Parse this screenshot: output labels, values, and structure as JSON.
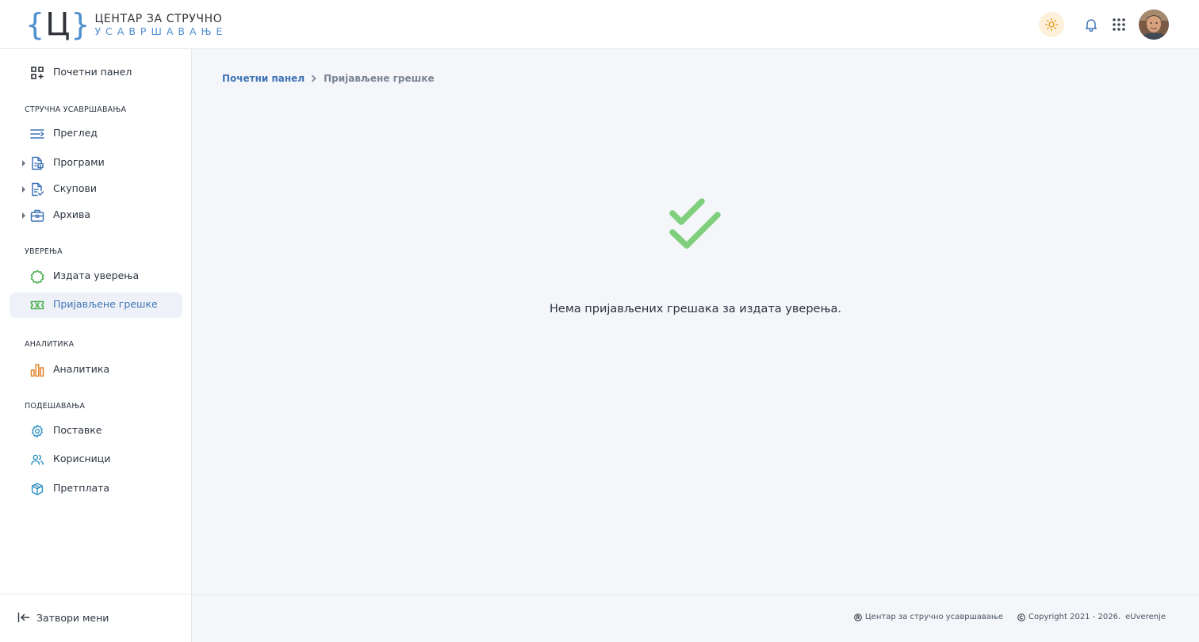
{
  "brand": {
    "logo_letter": "Ц",
    "line1": "ЦЕНТАР ЗА СТРУЧНО",
    "line2": "УСАВРШАВАЊЕ"
  },
  "header": {
    "theme_icon": "sun-icon",
    "notifications_icon": "bell-icon",
    "apps_icon": "grid-icon",
    "avatar": "user-avatar"
  },
  "sidebar": {
    "dashboard": {
      "label": "Почетни панел",
      "icon": "dashboard-icon"
    },
    "sections": {
      "training": "СТРУЧНА УСАВРШАВАЊА",
      "certificates": "УВЕРЕЊА",
      "analytics": "АНАЛИТИКА",
      "settings": "ПОДЕШАВАЊА"
    },
    "items": {
      "overview": {
        "label": "Преглед",
        "icon": "list-icon"
      },
      "programs": {
        "label": "Програми",
        "icon": "programs-icon"
      },
      "gatherings": {
        "label": "Скупови",
        "icon": "gatherings-icon"
      },
      "archive": {
        "label": "Архива",
        "icon": "archive-icon"
      },
      "issued": {
        "label": "Издата уверења",
        "icon": "badge-icon"
      },
      "reported": {
        "label": "Пријављене грешке",
        "icon": "ticket-x-icon"
      },
      "analytics": {
        "label": "Аналитика",
        "icon": "bar-chart-icon"
      },
      "preferences": {
        "label": "Поставке",
        "icon": "gear-icon"
      },
      "users": {
        "label": "Корисници",
        "icon": "users-icon"
      },
      "subscription": {
        "label": "Претплата",
        "icon": "box-icon"
      }
    },
    "close_menu": "Затвори мени"
  },
  "breadcrumb": {
    "home": "Почетни панел",
    "current": "Пријављене грешке"
  },
  "empty_state": {
    "icon": "double-check-icon",
    "message": "Нема пријављених грешака за издата уверења."
  },
  "footer": {
    "org": "Центар за стручно усавршавање",
    "copyright": "Copyright 2021 - 2026.",
    "product": "eUverenje"
  },
  "colors": {
    "accent": "#3f73b5",
    "logo_blue": "#4e8fcf",
    "success": "#7fcf7d",
    "analytics": "#e0822b",
    "certificates": "#4caf50"
  }
}
